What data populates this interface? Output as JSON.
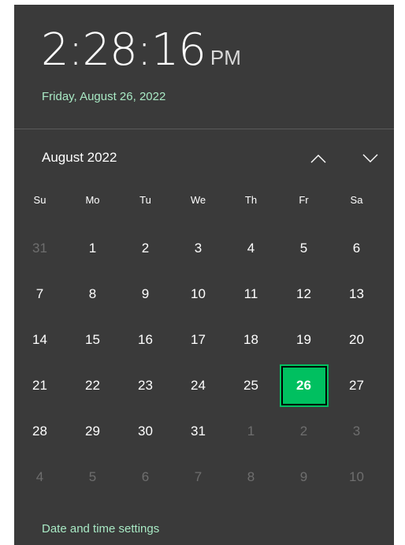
{
  "clock": {
    "time": "2:28:16",
    "ampm": "PM",
    "date_long": "Friday, August 26, 2022"
  },
  "calendar": {
    "month_label": "August 2022",
    "nav_up_icon": "chevron-up-icon",
    "nav_down_icon": "chevron-down-icon",
    "weekdays": [
      "Su",
      "Mo",
      "Tu",
      "We",
      "Th",
      "Fr",
      "Sa"
    ],
    "weeks": [
      [
        {
          "d": "31",
          "other": true
        },
        {
          "d": "1"
        },
        {
          "d": "2"
        },
        {
          "d": "3"
        },
        {
          "d": "4"
        },
        {
          "d": "5"
        },
        {
          "d": "6"
        }
      ],
      [
        {
          "d": "7"
        },
        {
          "d": "8"
        },
        {
          "d": "9"
        },
        {
          "d": "10"
        },
        {
          "d": "11"
        },
        {
          "d": "12"
        },
        {
          "d": "13"
        }
      ],
      [
        {
          "d": "14"
        },
        {
          "d": "15"
        },
        {
          "d": "16"
        },
        {
          "d": "17"
        },
        {
          "d": "18"
        },
        {
          "d": "19"
        },
        {
          "d": "20"
        }
      ],
      [
        {
          "d": "21"
        },
        {
          "d": "22"
        },
        {
          "d": "23"
        },
        {
          "d": "24"
        },
        {
          "d": "25"
        },
        {
          "d": "26",
          "today": true
        },
        {
          "d": "27"
        }
      ],
      [
        {
          "d": "28"
        },
        {
          "d": "29"
        },
        {
          "d": "30"
        },
        {
          "d": "31"
        },
        {
          "d": "1",
          "other": true
        },
        {
          "d": "2",
          "other": true
        },
        {
          "d": "3",
          "other": true
        }
      ],
      [
        {
          "d": "4",
          "other": true
        },
        {
          "d": "5",
          "other": true
        },
        {
          "d": "6",
          "other": true
        },
        {
          "d": "7",
          "other": true
        },
        {
          "d": "8",
          "other": true
        },
        {
          "d": "9",
          "other": true
        },
        {
          "d": "10",
          "other": true
        }
      ]
    ]
  },
  "footer": {
    "settings_link": "Date and time settings"
  },
  "colors": {
    "panel_bg": "#3a3a3a",
    "accent_text": "#a8e9c4",
    "today_bg": "#00c060",
    "other_month_text": "#6e6e6e"
  }
}
